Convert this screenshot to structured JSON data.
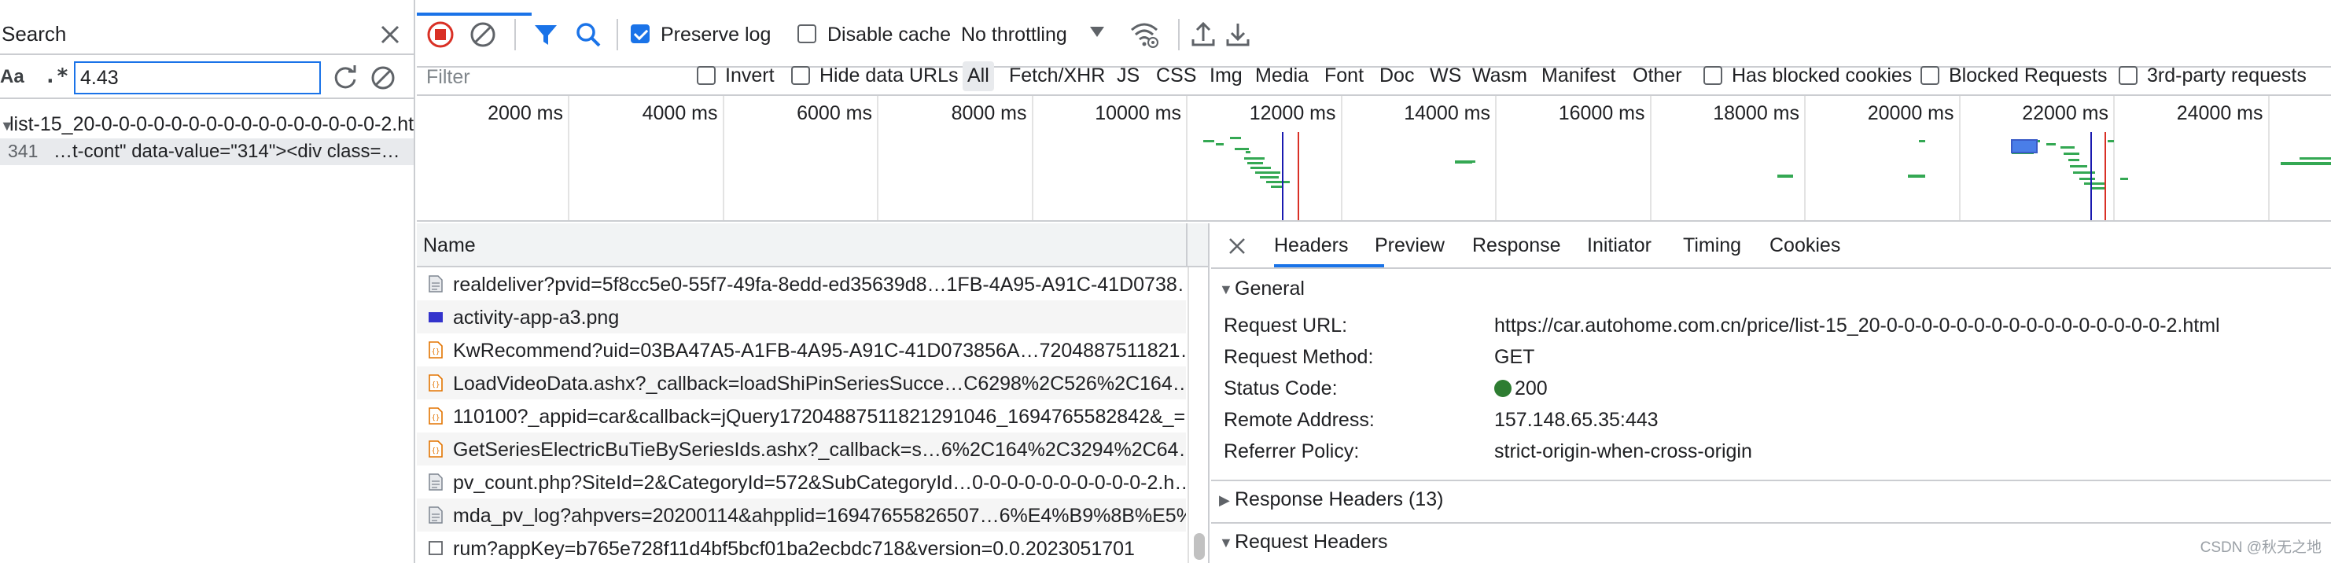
{
  "search": {
    "title": "Search",
    "case_label": "Aa",
    "regex_label": ".*",
    "query": "4.43",
    "result_file": "list-15_20-0-0-0-0-0-0-0-0-0-0-0-0-0-0-0-0-2.ht...",
    "result_line_number": "341",
    "result_snippet": "…t-cont\" data-value=\"314\"><div class=…"
  },
  "toolbar": {
    "preserve_log": "Preserve log",
    "disable_cache": "Disable cache",
    "throttling": "No throttling"
  },
  "filterbar": {
    "placeholder": "Filter",
    "invert": "Invert",
    "hide_data_urls": "Hide data URLs",
    "all": "All",
    "types": [
      "Fetch/XHR",
      "JS",
      "CSS",
      "Img",
      "Media",
      "Font",
      "Doc",
      "WS",
      "Wasm",
      "Manifest",
      "Other"
    ],
    "has_blocked_cookies": "Has blocked cookies",
    "blocked_requests": "Blocked Requests",
    "third_party": "3rd-party requests"
  },
  "overview": {
    "ticks": [
      "2000 ms",
      "4000 ms",
      "6000 ms",
      "8000 ms",
      "10000 ms",
      "12000 ms",
      "14000 ms",
      "16000 ms",
      "18000 ms",
      "20000 ms",
      "22000 ms",
      "24000 ms"
    ]
  },
  "requests": {
    "column_name": "Name",
    "rows": [
      {
        "name": "realdeliver?pvid=5f8cc5e0-55f7-49fa-8edd-ed35639d8…1FB-4A95-A91C-41D0738…",
        "icon": "document-icon"
      },
      {
        "name": "activity-app-a3.png",
        "icon": "image-icon"
      },
      {
        "name": "KwRecommend?uid=03BA47A5-A1FB-4A95-A91C-41D073856A…7204887511821…",
        "icon": "script-icon"
      },
      {
        "name": "LoadVideoData.ashx?_callback=loadShiPinSeriesSucce…C6298%2C526%2C164…",
        "icon": "script-icon"
      },
      {
        "name": "110100?_appid=car&callback=jQuery17204887511821291046_1694765582842&_=…",
        "icon": "script-icon"
      },
      {
        "name": "GetSeriesElectricBuTieBySeriesIds.ashx?_callback=s…6%2C164%2C3294%2C64…",
        "icon": "script-icon"
      },
      {
        "name": "pv_count.php?SiteId=2&CategoryId=572&SubCategoryId…0-0-0-0-0-0-0-0-0-0-2.h…",
        "icon": "document-icon"
      },
      {
        "name": "mda_pv_log?ahpvers=20200114&ahpplid=16947655826507…6%E4%B9%8B%E5%…",
        "icon": "document-icon"
      },
      {
        "name": "rum?appKey=b765e728f11d4bf5bcf01ba2ecbdc718&version=0.0.2023051701",
        "icon": "blank-icon"
      }
    ]
  },
  "details": {
    "tabs": [
      "Headers",
      "Preview",
      "Response",
      "Initiator",
      "Timing",
      "Cookies"
    ],
    "general_label": "General",
    "general": [
      {
        "key": "Request URL:",
        "value": "https://car.autohome.com.cn/price/list-15_20-0-0-0-0-0-0-0-0-0-0-0-0-0-0-0-0-2.html"
      },
      {
        "key": "Request Method:",
        "value": "GET"
      },
      {
        "key": "Status Code:",
        "value": "200"
      },
      {
        "key": "Remote Address:",
        "value": "157.148.65.35:443"
      },
      {
        "key": "Referrer Policy:",
        "value": "strict-origin-when-cross-origin"
      }
    ],
    "response_headers_label": "Response Headers (13)",
    "request_headers_label": "Request Headers"
  },
  "watermark": "CSDN @秋无之地",
  "colors": {
    "accent": "#1a73e8",
    "record": "#d93025",
    "status_ok": "#2e7d32",
    "waterfall_green": "#34a853"
  }
}
